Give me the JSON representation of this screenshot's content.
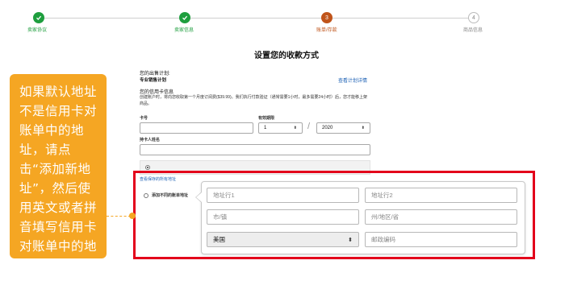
{
  "stepper": {
    "steps": [
      {
        "label": "卖家协议",
        "state": "done",
        "number": ""
      },
      {
        "label": "卖家信息",
        "state": "done",
        "number": ""
      },
      {
        "label": "账单/存款",
        "state": "active",
        "number": "3"
      },
      {
        "label": "商品信息",
        "state": "todo",
        "number": "4"
      }
    ]
  },
  "page": {
    "title": "设置您的收款方式"
  },
  "plan": {
    "heading": "您的出售计划:",
    "value": "专业销售计划",
    "view_link": "查看计划详情"
  },
  "credit_card": {
    "heading": "您的信用卡信息",
    "description": "创建账户时，将向您收取第一个月度订阅费($39.99)。我们执行付款验证（通常需要1小时，最多需要24小时）后，您才能移上架商品。",
    "card_number_label": "卡号",
    "expiry_label": "有效期限",
    "expiry_month": "1",
    "expiry_separator": "/",
    "expiry_year": "2020",
    "cardholder_label": "持卡人姓名",
    "view_saved_addresses_link": "查看保存的所有地址",
    "add_billing_address_label": "添加不同的账单地址"
  },
  "address_form": {
    "line1_placeholder": "地址行1",
    "line2_placeholder": "地址行2",
    "city_placeholder": "市/镇",
    "state_placeholder": "州/地区/省",
    "country_value": "美国",
    "postal_placeholder": "邮政编码"
  },
  "callout": {
    "text": "如果默认地址不是信用卡对账单中的地址，请点击“添加新地址”，然后使用英文或者拼音填写信用卡对账单中的地址"
  },
  "colors": {
    "done": "#1e9e3e",
    "active": "#c0541a",
    "callout": "#f5a623",
    "highlight": "#e3001b",
    "link": "#1a5fb4"
  },
  "icons": {
    "done_step": "check-icon",
    "select": "updown-arrow-icon"
  }
}
